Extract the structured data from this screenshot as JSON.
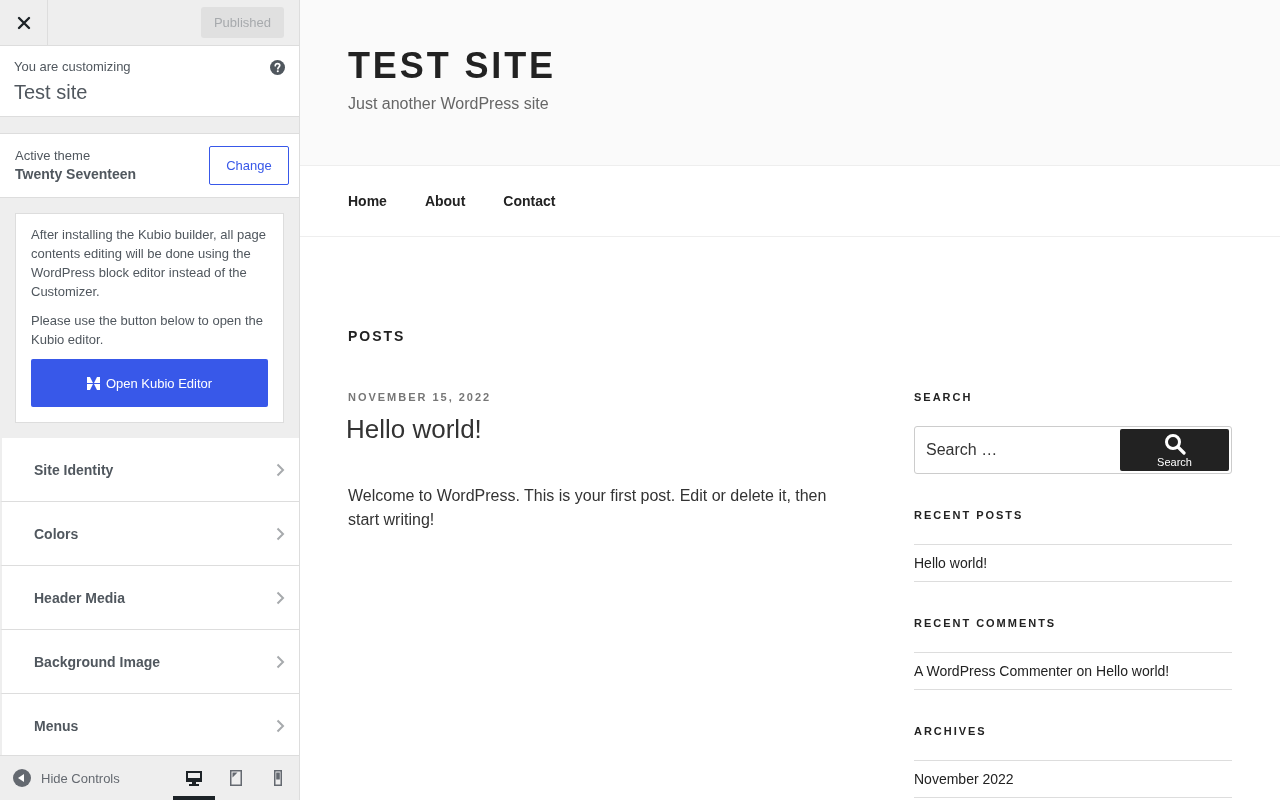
{
  "customizer": {
    "publish_button": {
      "label": "Published",
      "disabled": true
    },
    "info": {
      "caption": "You are customizing",
      "site_name": "Test site"
    },
    "theme": {
      "caption": "Active theme",
      "name": "Twenty Seventeen",
      "button": "Change"
    },
    "notice": {
      "paragraphs": [
        "After installing the Kubio builder, all page contents editing will be done using the WordPress block editor instead of the Customizer.",
        "Please use the button below to open the Kubio editor."
      ],
      "button": "Open Kubio Editor"
    },
    "sections": [
      "Site Identity",
      "Colors",
      "Header Media",
      "Background Image",
      "Menus"
    ],
    "footer": {
      "hide_controls": "Hide Controls",
      "devices": [
        {
          "kind": "desktop",
          "selected": true
        },
        {
          "kind": "tablet",
          "selected": false
        },
        {
          "kind": "mobile",
          "selected": false
        }
      ]
    }
  },
  "preview": {
    "site_title": "TEST SITE",
    "tagline": "Just another WordPress site",
    "nav": [
      "Home",
      "About",
      "Contact"
    ],
    "page_heading": "POSTS",
    "post": {
      "date": "NOVEMBER 15, 2022",
      "title": "Hello world!",
      "body": "Welcome to WordPress. This is your first post. Edit or delete it, then start writing!"
    },
    "widgets": [
      {
        "kind": "search",
        "title": "SEARCH",
        "placeholder": "Search …",
        "button": "Search"
      },
      {
        "kind": "links",
        "title": "RECENT POSTS",
        "items": [
          "Hello world!"
        ]
      },
      {
        "kind": "comments",
        "title": "RECENT COMMENTS",
        "items": [
          {
            "author": "A WordPress Commenter",
            "joiner": "on",
            "post": "Hello world!"
          }
        ]
      },
      {
        "kind": "links",
        "title": "ARCHIVES",
        "items": [
          "November 2022"
        ]
      }
    ]
  }
}
